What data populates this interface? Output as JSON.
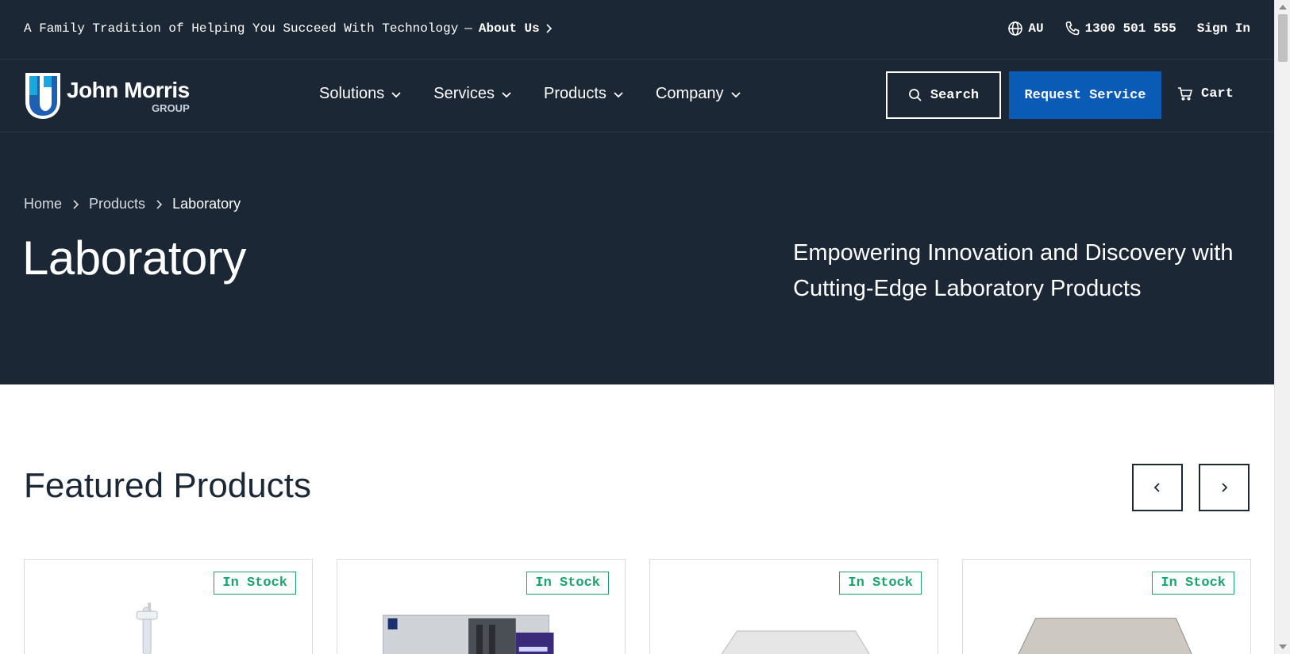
{
  "topbar": {
    "tagline": "A Family Tradition of Helping You Succeed With Technology",
    "tagline_link": "About Us",
    "region": "AU",
    "phone": "1300 501 555",
    "sign_in": "Sign In"
  },
  "brand": {
    "name": "John Morris",
    "sub": "GROUP",
    "accent_color": "#1aa7e0"
  },
  "nav": {
    "items": [
      {
        "label": "Solutions"
      },
      {
        "label": "Services"
      },
      {
        "label": "Products"
      },
      {
        "label": "Company"
      }
    ],
    "search_label": "Search",
    "request_label": "Request Service",
    "cart_label": "Cart"
  },
  "hero": {
    "breadcrumb": [
      "Home",
      "Products",
      "Laboratory"
    ],
    "title": "Laboratory",
    "lede": "Empowering Innovation and Discovery with Cutting-Edge Laboratory Products"
  },
  "featured": {
    "title": "Featured Products",
    "cards": [
      {
        "badge": "In Stock",
        "image_icon": "pipette-image"
      },
      {
        "badge": "In Stock",
        "image_icon": "lab-cabinet-image"
      },
      {
        "badge": "In Stock",
        "image_icon": "tip-rack-image"
      },
      {
        "badge": "In Stock",
        "image_icon": "tip-box-image"
      }
    ]
  },
  "colors": {
    "navy": "#1c2736",
    "primary_blue": "#0a5bb5",
    "stock_green": "#1ba36b"
  }
}
